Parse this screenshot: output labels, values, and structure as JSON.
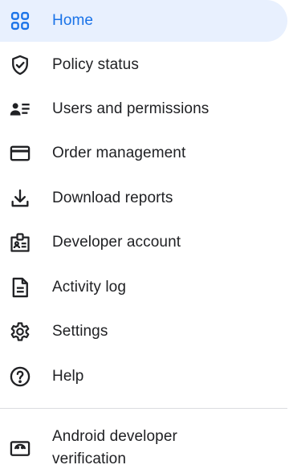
{
  "colors": {
    "active_background": "#e8f0fe",
    "active_text": "#1a73e8",
    "text": "#202124",
    "icon": "#202124",
    "divider": "#dadce0"
  },
  "nav": {
    "items": [
      {
        "label": "Home",
        "icon": "home-grid-icon",
        "active": true
      },
      {
        "label": "Policy status",
        "icon": "shield-check-icon",
        "active": false
      },
      {
        "label": "Users and permissions",
        "icon": "users-icon",
        "active": false
      },
      {
        "label": "Order management",
        "icon": "credit-card-icon",
        "active": false
      },
      {
        "label": "Download reports",
        "icon": "download-icon",
        "active": false
      },
      {
        "label": "Developer account",
        "icon": "badge-icon",
        "active": false
      },
      {
        "label": "Activity log",
        "icon": "document-icon",
        "active": false
      },
      {
        "label": "Settings",
        "icon": "gear-icon",
        "active": false
      },
      {
        "label": "Help",
        "icon": "help-icon",
        "active": false
      }
    ],
    "footer_item": {
      "label": "Android developer verification",
      "icon": "android-icon",
      "active": false
    }
  }
}
